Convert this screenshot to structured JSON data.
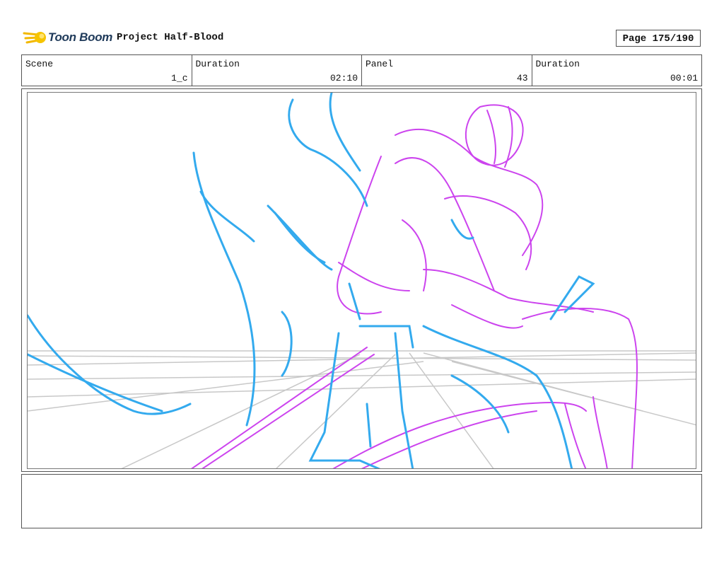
{
  "header": {
    "logo_text": "Toon Boom",
    "project_title": "Project Half-Blood",
    "page_label": "Page 175/190"
  },
  "info": {
    "scene_label": "Scene",
    "scene_value": "1_c",
    "duration_label": "Duration",
    "duration_value": "02:10",
    "panel_label": "Panel",
    "panel_value": "43",
    "panel_duration_label": "Duration",
    "panel_duration_value": "00:01"
  },
  "sketch": {
    "colors": {
      "character": "#33aaee",
      "effect": "#cc44ee",
      "grid": "#c8c8c8"
    }
  },
  "notes": {
    "text": ""
  }
}
